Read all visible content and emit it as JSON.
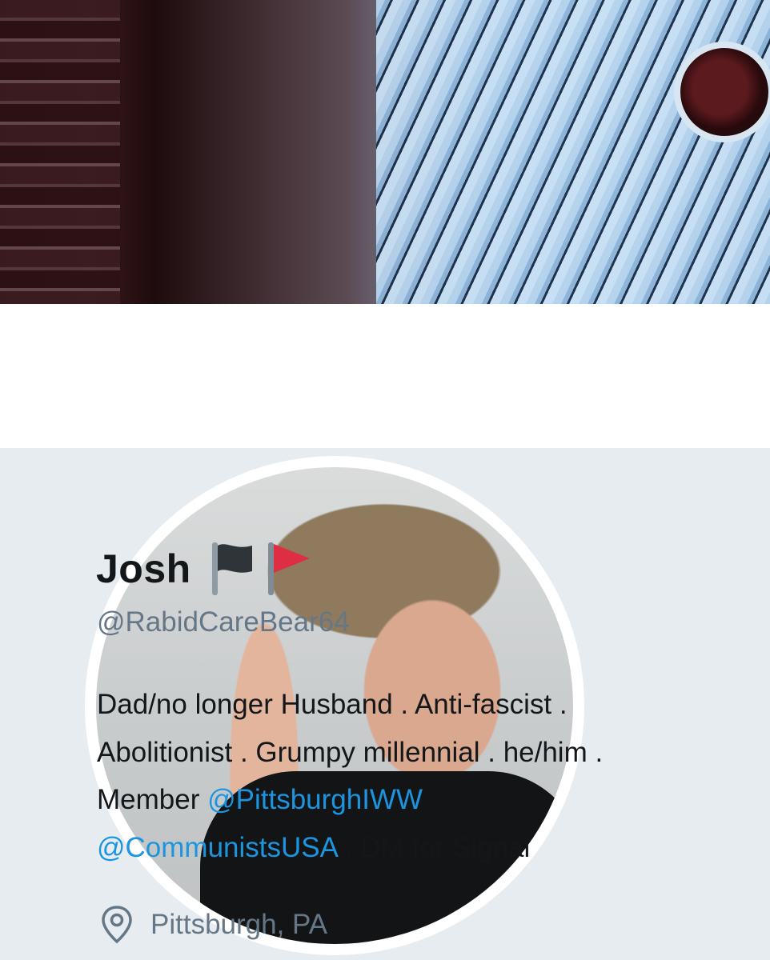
{
  "profile": {
    "name": "Josh",
    "name_emoji": [
      "black-flag",
      "red-flag"
    ],
    "handle": "@RabidCareBear64",
    "bio": {
      "line1": "Dad/no longer Husband . Anti-fascist .",
      "line2": "Abolitionist . Grumpy millennial . he/him .",
      "line3_prefix": "Member ",
      "mention1": "@PittsburghIWW",
      "mention2": "@CommunistsUSA",
      "line4_suffix": " . DM for Signal"
    },
    "location": "Pittsburgh, PA"
  },
  "colors": {
    "card_background": "#e6ecf0",
    "link": "#1b95e0",
    "secondary_text": "#657786",
    "primary_text": "#14171a"
  },
  "icons": {
    "location": "location-pin-icon"
  }
}
